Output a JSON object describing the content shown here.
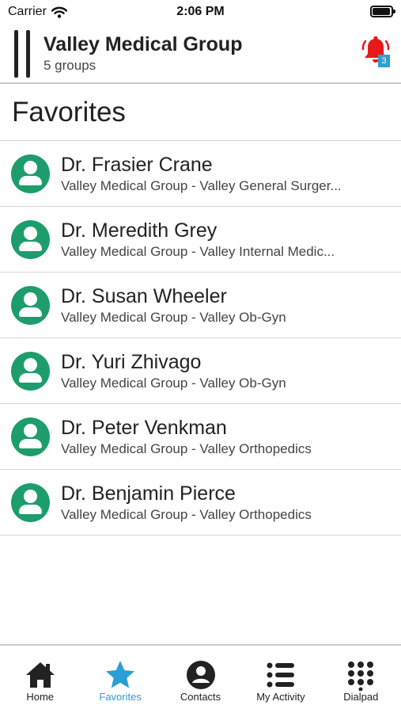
{
  "status_bar": {
    "carrier": "Carrier",
    "time": "2:06 PM",
    "battery_level": 0.95
  },
  "header": {
    "title": "Valley Medical Group",
    "subtitle": "5 groups",
    "notification_count": "3",
    "menu_icon": "sidebar-toggle-icon",
    "bell_icon": "bell-icon"
  },
  "section": {
    "title": "Favorites"
  },
  "favorites": [
    {
      "name": "Dr. Frasier Crane",
      "detail": "Valley Medical Group - Valley General Surger..."
    },
    {
      "name": "Dr. Meredith Grey",
      "detail": "Valley Medical Group - Valley Internal Medic..."
    },
    {
      "name": "Dr. Susan Wheeler",
      "detail": "Valley Medical Group - Valley Ob-Gyn"
    },
    {
      "name": "Dr. Yuri Zhivago",
      "detail": "Valley Medical Group - Valley Ob-Gyn"
    },
    {
      "name": "Dr. Peter Venkman",
      "detail": "Valley Medical Group - Valley Orthopedics"
    },
    {
      "name": "Dr. Benjamin Pierce",
      "detail": "Valley Medical Group - Valley Orthopedics"
    }
  ],
  "tabs": [
    {
      "label": "Home",
      "icon": "home-icon",
      "active": false
    },
    {
      "label": "Favorites",
      "icon": "star-icon",
      "active": true
    },
    {
      "label": "Contacts",
      "icon": "contact-icon",
      "active": false
    },
    {
      "label": "My Activity",
      "icon": "list-icon",
      "active": false
    },
    {
      "label": "Dialpad",
      "icon": "dialpad-icon",
      "active": false
    }
  ],
  "colors": {
    "avatar": "#1c9d6b",
    "accent": "#2a9fd6",
    "alert": "#e8191b",
    "text": "#222222"
  }
}
